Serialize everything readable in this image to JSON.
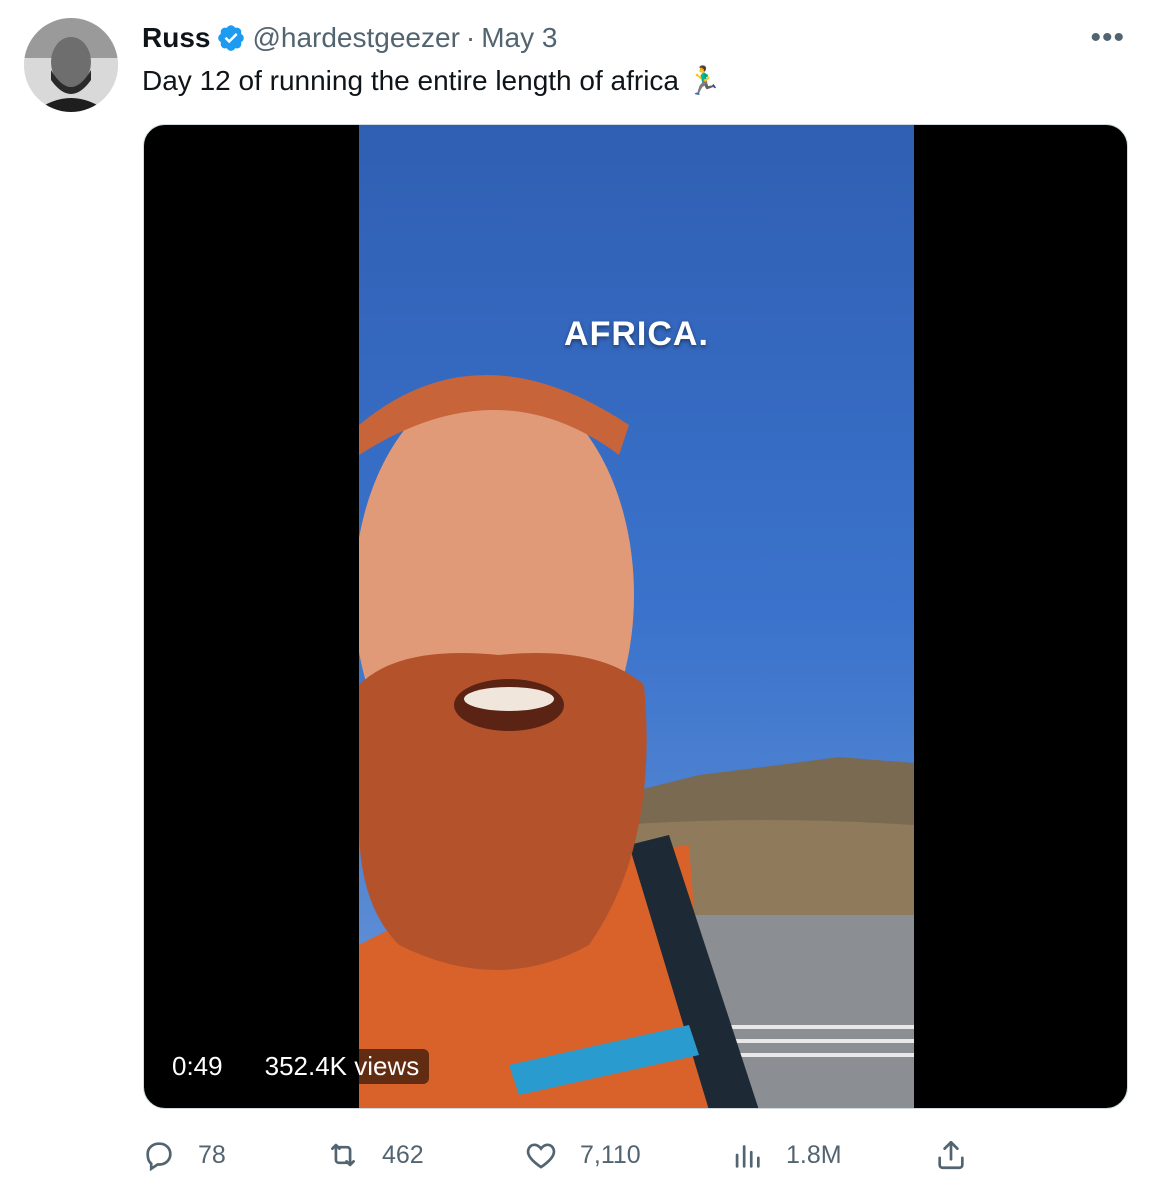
{
  "author": {
    "name": "Russ",
    "handle": "@hardestgeezer",
    "separator": "·",
    "date": "May 3"
  },
  "tweet": {
    "text": "Day 12 of running the entire length of africa 🏃‍♂️"
  },
  "media": {
    "overlay_text": "AFRICA.",
    "duration": "0:49",
    "views": "352.4K views"
  },
  "actions": {
    "replies": "78",
    "retweets": "462",
    "likes": "7,110",
    "views": "1.8M"
  },
  "icons": {
    "verified": "verified-badge-icon",
    "more": "more-icon",
    "reply": "reply-icon",
    "retweet": "retweet-icon",
    "like": "heart-icon",
    "views": "views-chart-icon",
    "share": "share-icon"
  },
  "colors": {
    "verified_blue": "#1d9bf0",
    "secondary_text": "#536471",
    "primary_text": "#0f1419"
  }
}
